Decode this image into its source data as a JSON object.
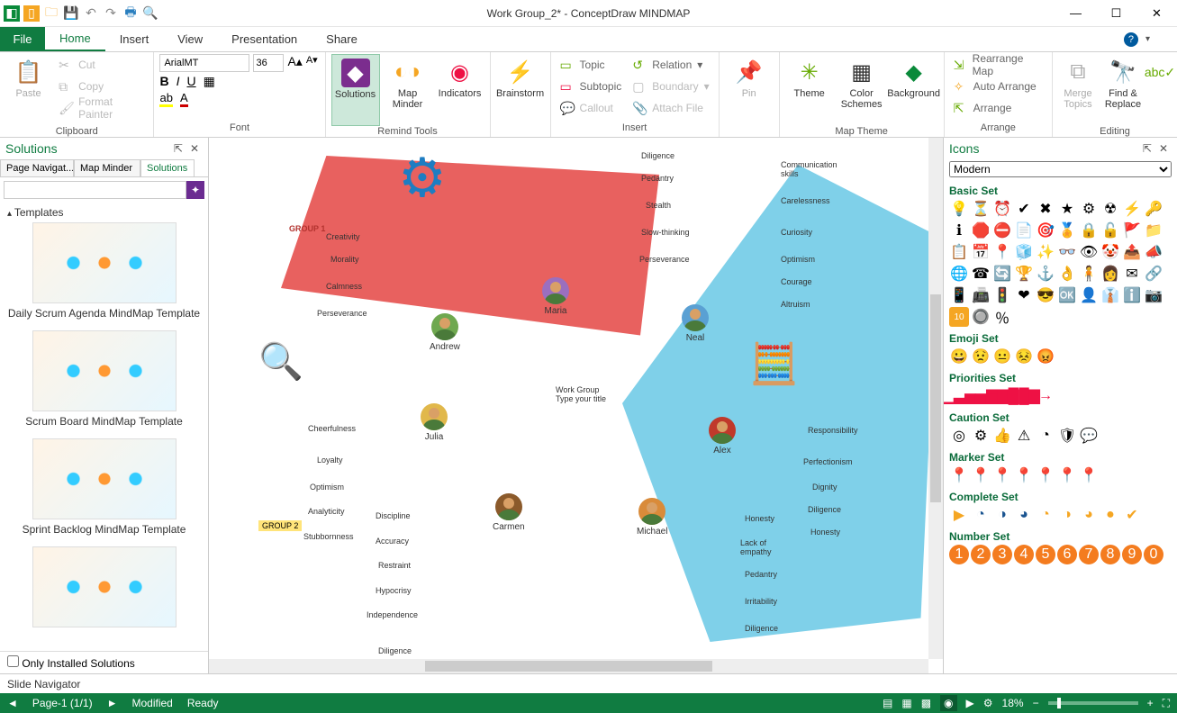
{
  "app": {
    "title": "Work Group_2* - ConceptDraw MINDMAP"
  },
  "menu": {
    "file": "File",
    "tabs": [
      "Home",
      "Insert",
      "View",
      "Presentation",
      "Share"
    ],
    "active": 0
  },
  "ribbon": {
    "clipboard": {
      "label": "Clipboard",
      "paste": "Paste",
      "cut": "Cut",
      "copy": "Copy",
      "format_painter": "Format Painter"
    },
    "font": {
      "label": "Font",
      "name": "ArialMT",
      "size": "36"
    },
    "remind": {
      "label": "Remind Tools",
      "solutions": "Solutions",
      "map_minder": "Map Minder",
      "indicators": "Indicators"
    },
    "brainstorm": {
      "label": "Brainstorm"
    },
    "insert": {
      "label": "Insert",
      "topic": "Topic",
      "subtopic": "Subtopic",
      "callout": "Callout",
      "relation": "Relation",
      "boundary": "Boundary",
      "attach_file": "Attach  File"
    },
    "pin": {
      "label": "Pin"
    },
    "maptheme": {
      "label": "Map Theme",
      "theme": "Theme",
      "color_schemes": "Color Schemes",
      "background": "Background"
    },
    "arrange": {
      "label": "Arrange",
      "rearrange": "Rearrange Map",
      "auto": "Auto Arrange",
      "arrange": "Arrange"
    },
    "editing": {
      "label": "Editing",
      "merge": "Merge Topics",
      "find": "Find & Replace"
    }
  },
  "left": {
    "title": "Solutions",
    "subtabs": [
      "Page Navigat...",
      "Map Minder",
      "Solutions"
    ],
    "active_subtab": 2,
    "templates_header": "Templates",
    "templates": [
      "Daily Scrum Agenda MindMap Template",
      "Scrum Board MindMap Template",
      "Sprint Backlog MindMap Template"
    ],
    "only_installed": "Only Installed Solutions"
  },
  "canvas": {
    "center_title": "Work Group",
    "center_hint": "Type your title",
    "group1": "GROUP 1",
    "group2": "GROUP 2",
    "people": {
      "andrew": "Andrew",
      "maria": "Maria",
      "neal": "Neal",
      "julia": "Julia",
      "carmen": "Carmen",
      "michael": "Michael",
      "alex": "Alex"
    },
    "andrew_traits": [
      "Creativity",
      "Morality",
      "Calmness",
      "Perseverance"
    ],
    "maria_traits": [
      "Diligence",
      "Pedantry",
      "Stealth",
      "Slow-thinking",
      "Perseverance"
    ],
    "neal_traits": [
      "Communication skills",
      "Carelessness",
      "Curiosity",
      "Optimism",
      "Courage",
      "Altruism"
    ],
    "julia_traits": [
      "Cheerfulness",
      "Loyalty",
      "Optimism",
      "Analyticity",
      "Stubbornness"
    ],
    "carmen_traits": [
      "Discipline",
      "Accuracy",
      "Restraint",
      "Hypocrisy",
      "Independence",
      "Diligence"
    ],
    "michael_traits": [
      "Honesty",
      "Lack of empathy",
      "Pedantry",
      "Irritability",
      "Diligence"
    ],
    "alex_traits": [
      "Responsibility",
      "Perfectionism",
      "Dignity",
      "Diligence",
      "Honesty"
    ]
  },
  "right": {
    "title": "Icons",
    "category": "Modern",
    "sets": {
      "basic": "Basic Set",
      "emoji": "Emoji Set",
      "priorities": "Priorities Set",
      "caution": "Caution Set",
      "marker": "Marker Set",
      "complete": "Complete Set",
      "number": "Number Set"
    }
  },
  "slide_nav": "Slide Navigator",
  "status": {
    "page": "Page-1 (1/1)",
    "modified": "Modified",
    "ready": "Ready",
    "zoom": "18%"
  }
}
